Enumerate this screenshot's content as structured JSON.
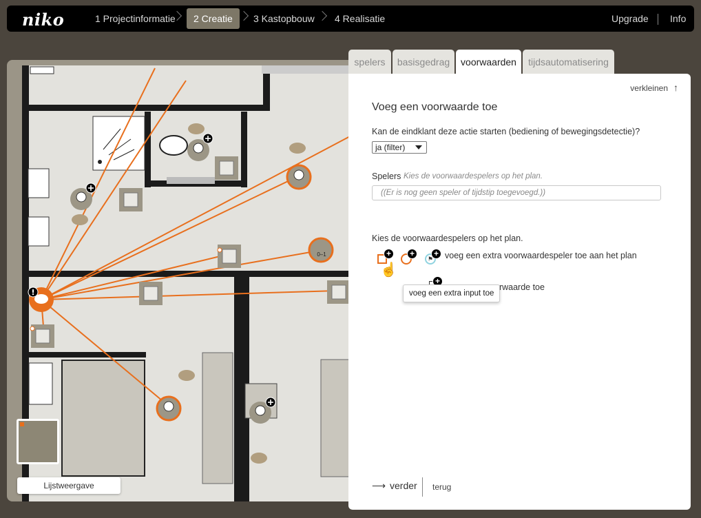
{
  "brand": "niko",
  "nav": {
    "steps": [
      {
        "label": "1 Projectinformatie",
        "active": false
      },
      {
        "label": "2 Creatie",
        "active": true
      },
      {
        "label": "3 Kastopbouw",
        "active": false
      },
      {
        "label": "4 Realisatie",
        "active": false
      }
    ],
    "upgrade": "Upgrade",
    "info": "Info"
  },
  "plan": {
    "list_view_label": "Lijstweergave",
    "player_indicators": [
      "0–1"
    ]
  },
  "tabs": [
    {
      "label": "spelers",
      "active": false
    },
    {
      "label": "basisgedrag",
      "active": false
    },
    {
      "label": "voorwaarden",
      "active": true
    },
    {
      "label": "tijdsautomatisering",
      "active": false
    }
  ],
  "panel": {
    "shrink_label": "verkleinen",
    "title": "Voeg een voorwaarde toe",
    "question": "Kan de eindklant deze actie starten (bediening of bewegingsdetectie)?",
    "filter_select": "ja (filter)",
    "players_label": "Spelers",
    "players_hint": "Kies de voorwaardespelers op het plan.",
    "players_field": "((Er is nog geen speler of tijdstip toegevoegd.))",
    "choose_label": "Kies de voorwaardespelers op het plan.",
    "add_player_text": "voeg een extra voorwaardespeler toe aan het plan",
    "add_condition_text": "orwaarde toe",
    "tooltip": "voeg een extra input toe",
    "next_label": "verder",
    "back_label": "terug"
  },
  "colors": {
    "accent": "#e86f1d",
    "topbar": "#000000",
    "active_step": "#7d7767",
    "background": "#4b453d"
  }
}
